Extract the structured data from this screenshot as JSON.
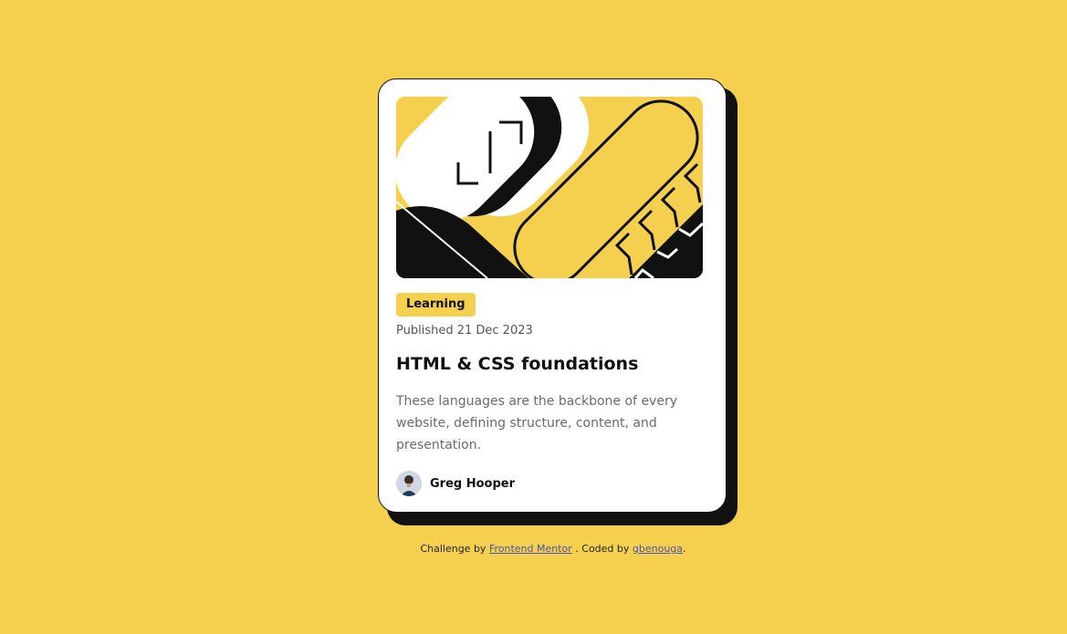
{
  "colors": {
    "background": "#f4d04e",
    "card": "#ffffff",
    "ink": "#111111",
    "link": "#4a52b8"
  },
  "card": {
    "image_icon": "abstract-illustration",
    "tag": "Learning",
    "published": "Published 21 Dec 2023",
    "title": "HTML & CSS foundations",
    "description": "These languages are the backbone of every website, defining structure, content, and presentation.",
    "author": {
      "avatar_icon": "avatar-image",
      "name": "Greg Hooper"
    }
  },
  "attribution": {
    "challenge_prefix": "Challenge by",
    "challenge_link": "Frontend Mentor",
    "coded_prefix": ". Coded by",
    "coded_link": "gbenouga",
    "suffix": "."
  }
}
